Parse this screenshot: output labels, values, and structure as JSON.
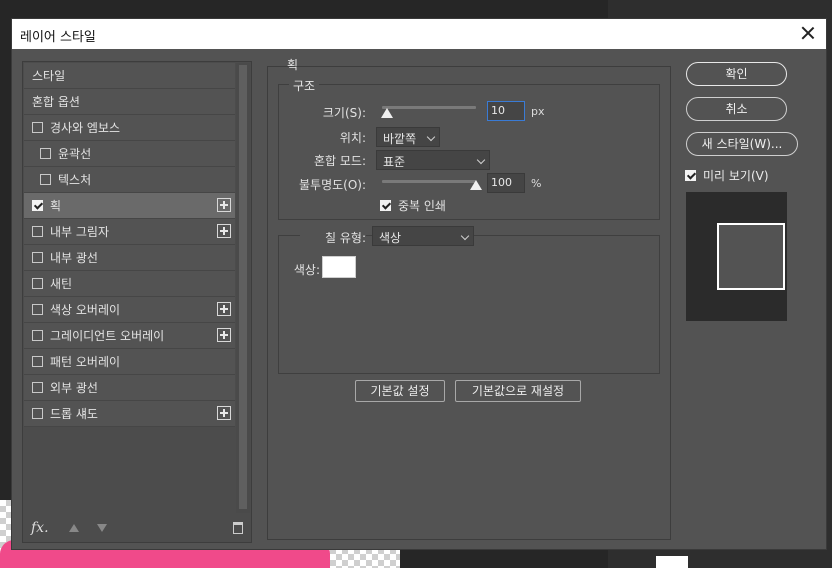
{
  "dialog": {
    "title": "레이어 스타일"
  },
  "styles_list": [
    {
      "label": "스타일",
      "has_checkbox": false,
      "checked": false,
      "has_plus": false,
      "indent": false,
      "selected": false
    },
    {
      "label": "혼합 옵션",
      "has_checkbox": false,
      "checked": false,
      "has_plus": false,
      "indent": false,
      "selected": false
    },
    {
      "label": "경사와 엠보스",
      "has_checkbox": true,
      "checked": false,
      "has_plus": false,
      "indent": false,
      "selected": false
    },
    {
      "label": "윤곽선",
      "has_checkbox": true,
      "checked": false,
      "has_plus": false,
      "indent": true,
      "selected": false
    },
    {
      "label": "텍스처",
      "has_checkbox": true,
      "checked": false,
      "has_plus": false,
      "indent": true,
      "selected": false
    },
    {
      "label": "획",
      "has_checkbox": true,
      "checked": true,
      "has_plus": true,
      "indent": false,
      "selected": true
    },
    {
      "label": "내부 그림자",
      "has_checkbox": true,
      "checked": false,
      "has_plus": true,
      "indent": false,
      "selected": false
    },
    {
      "label": "내부 광선",
      "has_checkbox": true,
      "checked": false,
      "has_plus": false,
      "indent": false,
      "selected": false
    },
    {
      "label": "새틴",
      "has_checkbox": true,
      "checked": false,
      "has_plus": false,
      "indent": false,
      "selected": false
    },
    {
      "label": "색상 오버레이",
      "has_checkbox": true,
      "checked": false,
      "has_plus": true,
      "indent": false,
      "selected": false
    },
    {
      "label": "그레이디언트 오버레이",
      "has_checkbox": true,
      "checked": false,
      "has_plus": true,
      "indent": false,
      "selected": false
    },
    {
      "label": "패턴 오버레이",
      "has_checkbox": true,
      "checked": false,
      "has_plus": false,
      "indent": false,
      "selected": false
    },
    {
      "label": "외부 광선",
      "has_checkbox": true,
      "checked": false,
      "has_plus": false,
      "indent": false,
      "selected": false
    },
    {
      "label": "드롭 섀도",
      "has_checkbox": true,
      "checked": false,
      "has_plus": true,
      "indent": false,
      "selected": false
    }
  ],
  "footer": {
    "fx_label": "fx."
  },
  "stroke": {
    "section_title": "획",
    "structure": {
      "group_label": "구조",
      "size_label": "크기(S):",
      "size_value": "10",
      "size_unit": "px",
      "size_slider_fraction": 0.05,
      "position_label": "위치:",
      "position_value": "바깥쪽",
      "blend_label": "혼합 모드:",
      "blend_value": "표준",
      "opacity_label": "불투명도(O):",
      "opacity_value": "100",
      "opacity_unit": "%",
      "opacity_slider_fraction": 1.0,
      "overprint_label": "중복 인쇄",
      "overprint_checked": true
    },
    "fill": {
      "fill_type_label": "칠 유형:",
      "fill_type_value": "색상",
      "color_label": "색상:",
      "color_value": "#ffffff"
    },
    "buttons": {
      "make_default": "기본값 설정",
      "reset_default": "기본값으로 재설정"
    }
  },
  "right": {
    "ok": "확인",
    "cancel": "취소",
    "new_style": "새 스타일(W)...",
    "preview_label": "미리 보기(V)",
    "preview_checked": true
  }
}
